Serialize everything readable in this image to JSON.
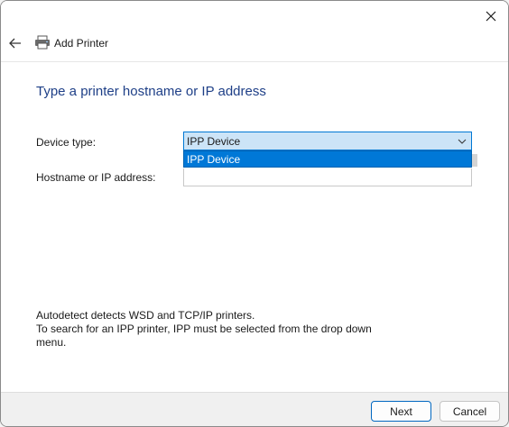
{
  "window": {
    "close_icon": "close-icon"
  },
  "header": {
    "back_icon": "back-arrow-icon",
    "printer_icon": "printer-icon",
    "title": "Add Printer"
  },
  "main": {
    "title": "Type a printer hostname or IP address",
    "device_type_label": "Device type:",
    "device_type_value": "IPP Device",
    "dropdown_options": [
      "IPP Device"
    ],
    "dropdown_highlighted": "IPP Device",
    "hostname_label": "Hostname or IP address:",
    "hostname_value": "",
    "info_line1": "Autodetect detects WSD and TCP/IP printers.",
    "info_line2": "To search for an IPP printer, IPP must be selected from the drop down menu."
  },
  "footer": {
    "next_label": "Next",
    "cancel_label": "Cancel"
  },
  "colors": {
    "title_blue": "#1e3f87",
    "accent": "#0078d7",
    "select_bg": "#cce4f7"
  }
}
